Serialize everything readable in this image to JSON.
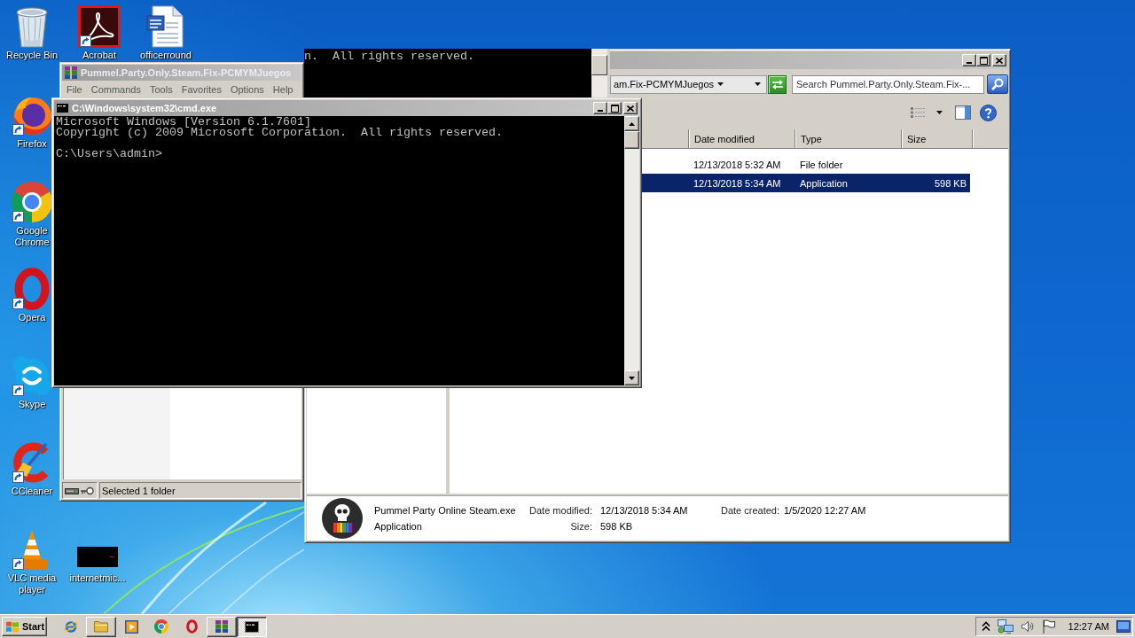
{
  "desktop_icons": [
    {
      "label": "Recycle Bin",
      "kind": "recycle",
      "shortcut": false
    },
    {
      "label": "Acrobat",
      "kind": "acrobat",
      "shortcut": true
    },
    {
      "label": "officerround",
      "kind": "word",
      "shortcut": false
    },
    {
      "label": "Firefox",
      "kind": "firefox",
      "shortcut": true
    },
    {
      "label": "Google Chrome",
      "kind": "chrome",
      "shortcut": true
    },
    {
      "label": "Opera",
      "kind": "opera",
      "shortcut": true
    },
    {
      "label": "Skype",
      "kind": "skype",
      "shortcut": true
    },
    {
      "label": "CCleaner",
      "kind": "ccleaner",
      "shortcut": true
    },
    {
      "label": "VLC media player",
      "kind": "vlc",
      "shortcut": true
    },
    {
      "label": "internetmic...",
      "kind": "thumbnail",
      "shortcut": false
    }
  ],
  "explorer_window": {
    "breadcrumb": "am.Fix-PCMYMJuegos",
    "search": {
      "placeholder": "Search Pummel.Party.Only.Steam.Fix-..."
    },
    "columns": [
      "Date modified",
      "Type",
      "Size"
    ],
    "rows": [
      {
        "date_modified": "12/13/2018 5:32 AM",
        "type": "File folder",
        "selected": false
      },
      {
        "date_modified": "12/13/2018 5:34 AM",
        "type": "Application",
        "size": "598 KB",
        "selected": true
      }
    ],
    "details": {
      "name": "Pummel Party Online Steam.exe",
      "type": "Application",
      "fields": [
        {
          "label": "Date modified:",
          "value": "12/13/2018 5:34 AM"
        },
        {
          "label": "Size:",
          "value": "598 KB"
        },
        {
          "label": "Date created:",
          "value": "1/5/2020 12:27 AM"
        }
      ]
    }
  },
  "background_console": {
    "lines": [
      "n.  All rights reserved."
    ]
  },
  "winrar_window": {
    "title": "Pummel.Party.Only.Steam.Fix-PCMYMJuegos",
    "menu": [
      "File",
      "Commands",
      "Tools",
      "Favorites",
      "Options",
      "Help"
    ],
    "status": "Selected 1 folder"
  },
  "cmd_window": {
    "title": "C:\\Windows\\system32\\cmd.exe",
    "output": [
      "Microsoft Windows [Version 6.1.7601]",
      "Copyright (c) 2009 Microsoft Corporation.  All rights reserved."
    ],
    "prompt": "C:\\Users\\admin>"
  },
  "taskbar": {
    "start": "Start",
    "apps": [
      {
        "kind": "ie",
        "running": false,
        "selected": false
      },
      {
        "kind": "explorer",
        "running": true,
        "selected": false
      },
      {
        "kind": "mediaplayer",
        "running": false,
        "selected": false
      },
      {
        "kind": "chrome",
        "running": false,
        "selected": false
      },
      {
        "kind": "opera",
        "running": false,
        "selected": false
      },
      {
        "kind": "winrar",
        "running": true,
        "selected": false
      },
      {
        "kind": "cmd",
        "running": true,
        "selected": true
      }
    ],
    "clock": "12:27 AM"
  }
}
